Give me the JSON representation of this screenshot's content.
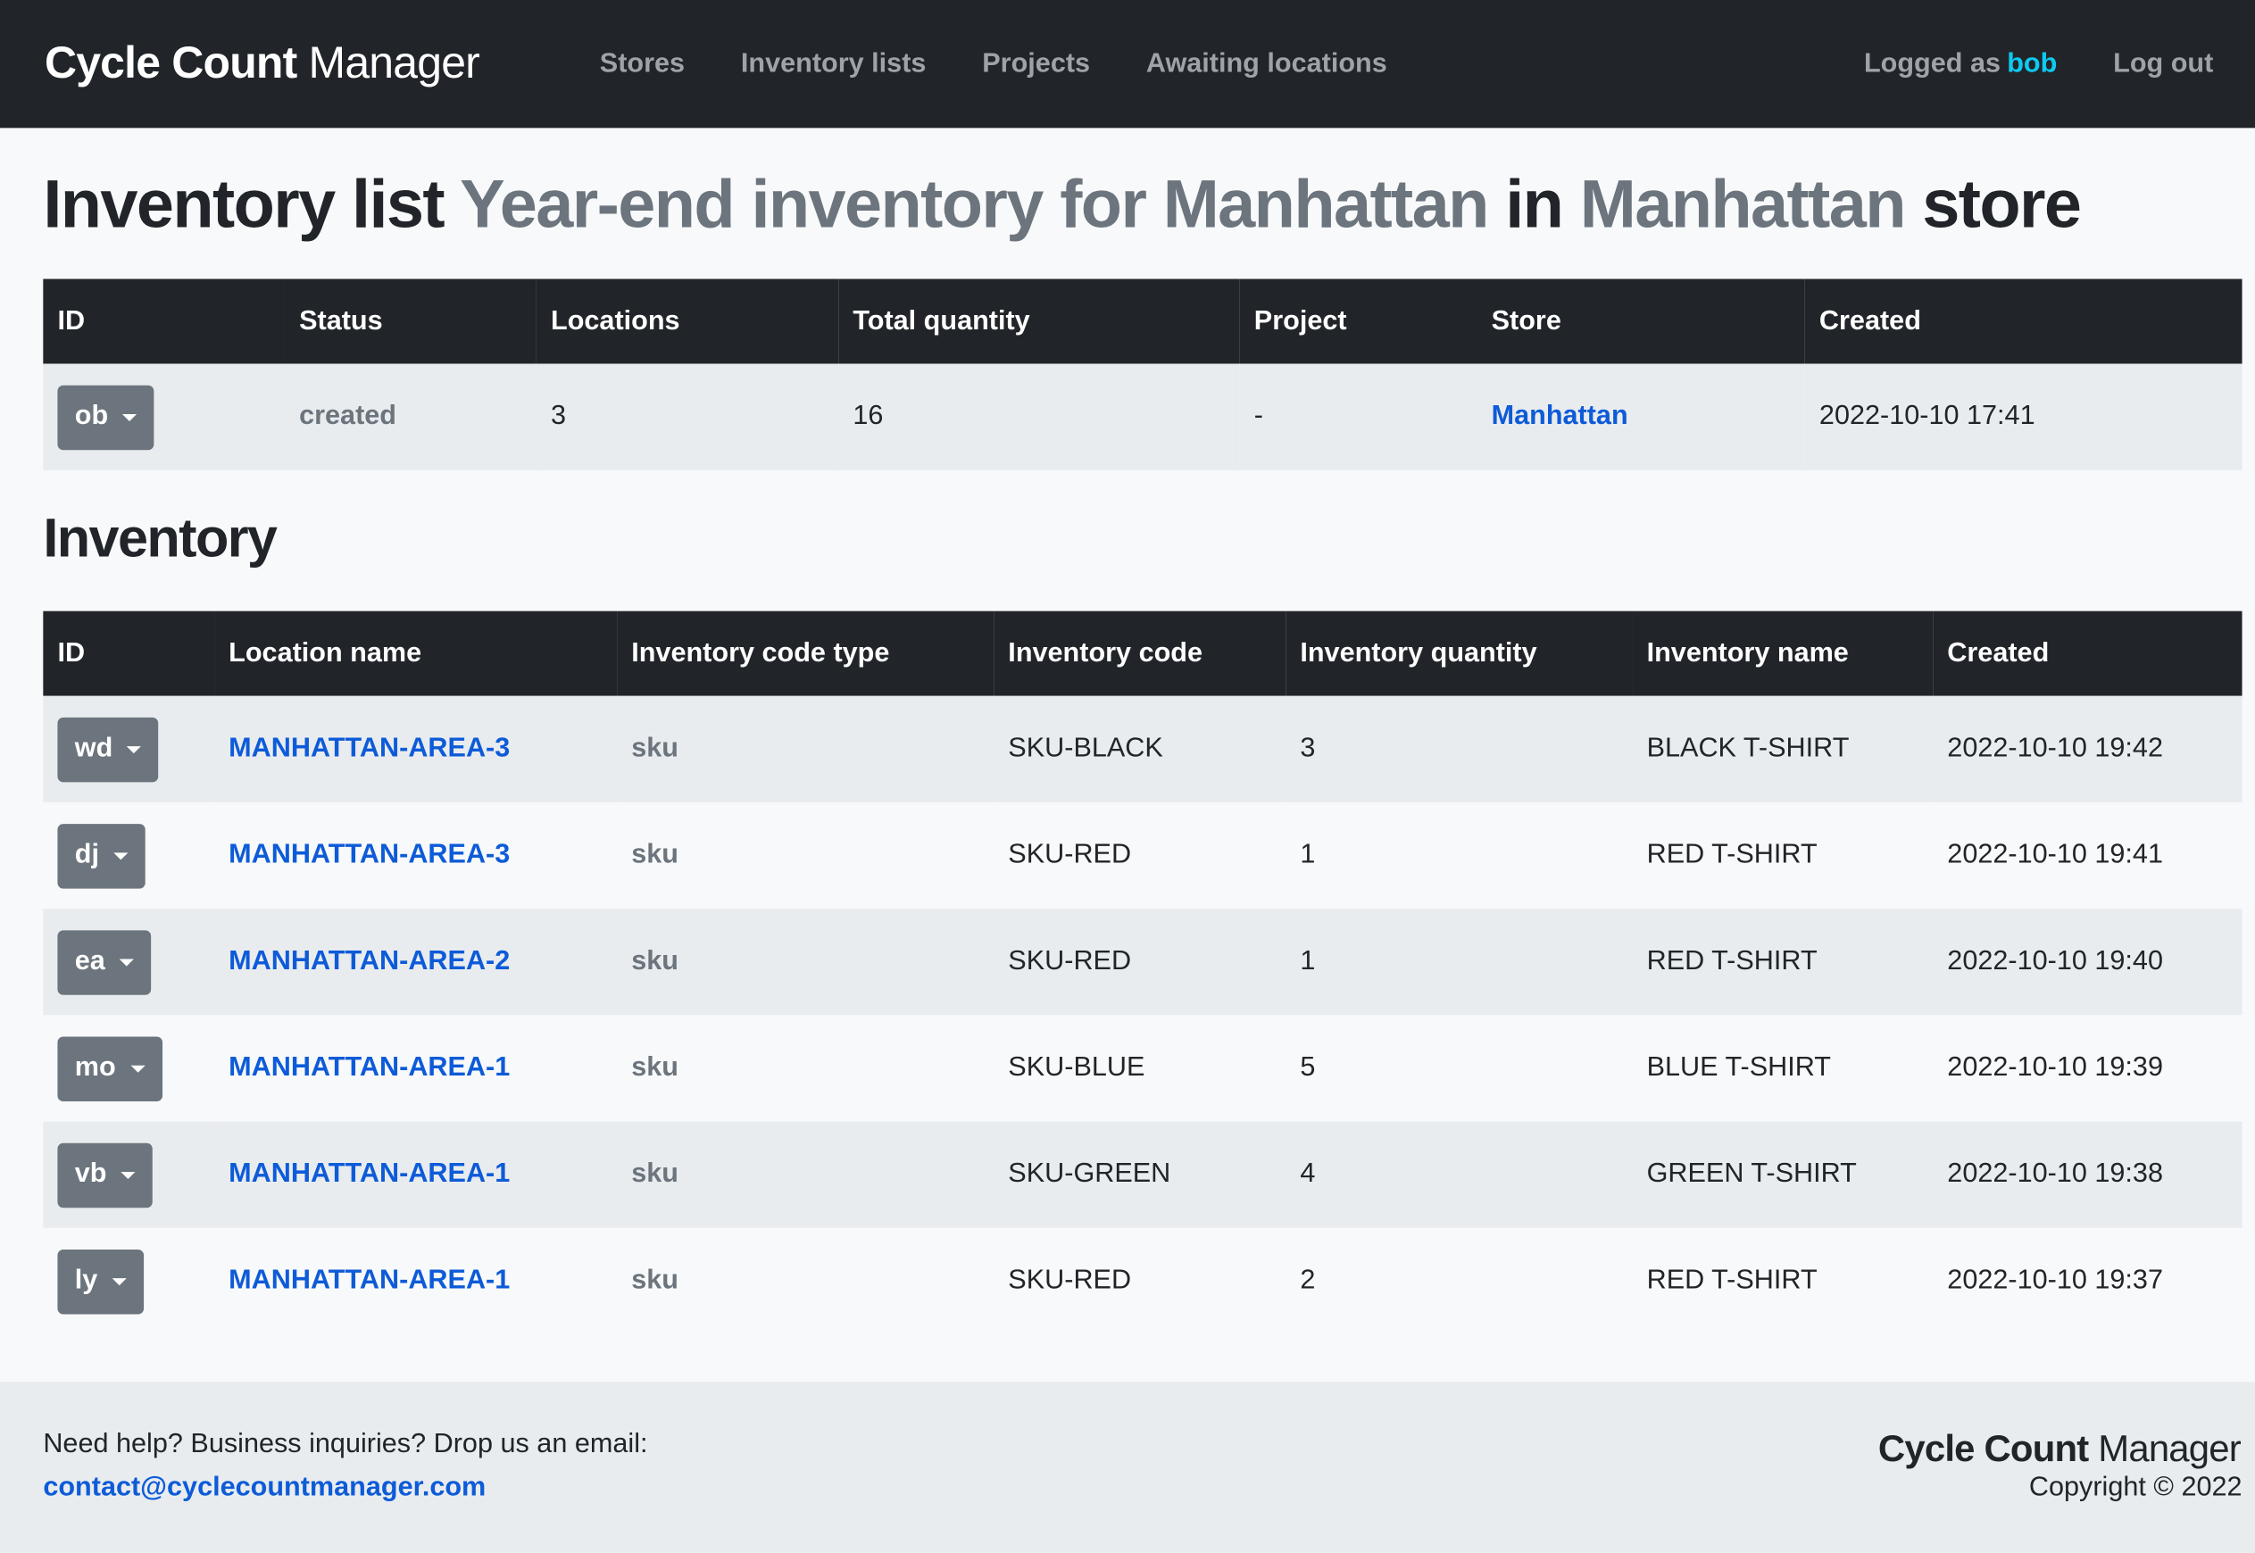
{
  "nav": {
    "brand_bold": "Cycle Count",
    "brand_light": "Manager",
    "links": [
      "Stores",
      "Inventory lists",
      "Projects",
      "Awaiting locations"
    ],
    "logged_as": "Logged as",
    "user": "bob",
    "logout": "Log out"
  },
  "heading": {
    "prefix": "Inventory list",
    "list_name": "Year-end inventory for Manhattan",
    "mid": "in",
    "store_name": "Manhattan",
    "suffix": "store"
  },
  "list_table": {
    "headers": [
      "ID",
      "Status",
      "Locations",
      "Total quantity",
      "Project",
      "Store",
      "Created"
    ],
    "row": {
      "id": "ob",
      "status": "created",
      "locations": "3",
      "total_quantity": "16",
      "project": "-",
      "store": "Manhattan",
      "created": "2022-10-10 17:41"
    }
  },
  "inventory_title": "Inventory",
  "inventory_table": {
    "headers": [
      "ID",
      "Location name",
      "Inventory code type",
      "Inventory code",
      "Inventory quantity",
      "Inventory name",
      "Created"
    ],
    "rows": [
      {
        "id": "wd",
        "location": "MANHATTAN-AREA-3",
        "code_type": "sku",
        "code": "SKU-BLACK",
        "qty": "3",
        "name": "BLACK T-SHIRT",
        "created": "2022-10-10 19:42"
      },
      {
        "id": "dj",
        "location": "MANHATTAN-AREA-3",
        "code_type": "sku",
        "code": "SKU-RED",
        "qty": "1",
        "name": "RED T-SHIRT",
        "created": "2022-10-10 19:41"
      },
      {
        "id": "ea",
        "location": "MANHATTAN-AREA-2",
        "code_type": "sku",
        "code": "SKU-RED",
        "qty": "1",
        "name": "RED T-SHIRT",
        "created": "2022-10-10 19:40"
      },
      {
        "id": "mo",
        "location": "MANHATTAN-AREA-1",
        "code_type": "sku",
        "code": "SKU-BLUE",
        "qty": "5",
        "name": "BLUE T-SHIRT",
        "created": "2022-10-10 19:39"
      },
      {
        "id": "vb",
        "location": "MANHATTAN-AREA-1",
        "code_type": "sku",
        "code": "SKU-GREEN",
        "qty": "4",
        "name": "GREEN T-SHIRT",
        "created": "2022-10-10 19:38"
      },
      {
        "id": "ly",
        "location": "MANHATTAN-AREA-1",
        "code_type": "sku",
        "code": "SKU-RED",
        "qty": "2",
        "name": "RED T-SHIRT",
        "created": "2022-10-10 19:37"
      }
    ]
  },
  "footer": {
    "help": "Need help? Business inquiries? Drop us an email:",
    "email": "contact@cyclecountmanager.com",
    "brand_bold": "Cycle Count",
    "brand_light": "Manager",
    "copyright": "Copyright © 2022"
  },
  "colors": {
    "navbar": "#212529",
    "link": "#0d5bd8",
    "user": "#0dcaf0",
    "id_button": "#6c757d"
  }
}
